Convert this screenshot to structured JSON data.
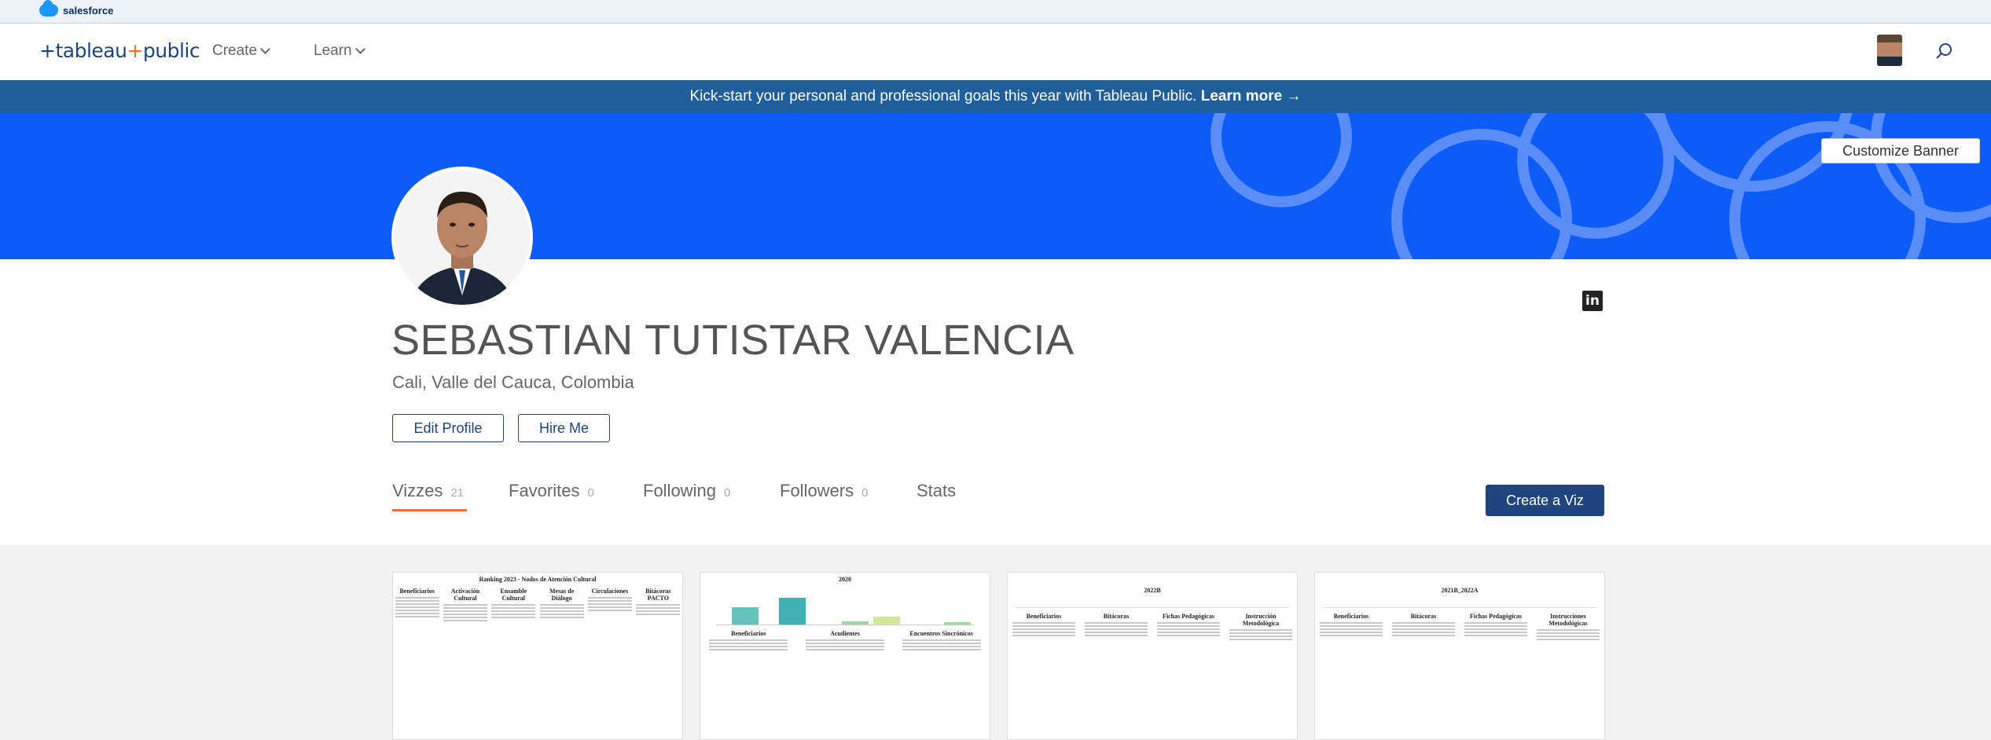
{
  "salesforce": {
    "brand": "salesforce"
  },
  "nav": {
    "logo_main": "+tableau",
    "logo_plus": "+",
    "logo_public": "public",
    "create": "Create",
    "learn": "Learn"
  },
  "promo": {
    "text": "Kick-start your personal and professional goals this year with Tableau Public. ",
    "link": "Learn more →"
  },
  "banner": {
    "customize": "Customize Banner"
  },
  "profile": {
    "name": "SEBASTIAN TUTISTAR VALENCIA",
    "location": "Cali, Valle del Cauca, Colombia",
    "edit": "Edit Profile",
    "hire": "Hire Me"
  },
  "tabs": [
    {
      "label": "Vizzes",
      "count": "21"
    },
    {
      "label": "Favorites",
      "count": "0"
    },
    {
      "label": "Following",
      "count": "0"
    },
    {
      "label": "Followers",
      "count": "0"
    },
    {
      "label": "Stats",
      "count": ""
    }
  ],
  "create_viz": "Create a Viz",
  "cards": [
    {
      "title": "Ranking 2023 - Nodos de Atención Cultural",
      "headers": [
        "Beneficiarios",
        "Activación Cultural",
        "Ensamble Cultural",
        "Mesas de Diálogo",
        "Circulaciones",
        "Bitácoras PACTO"
      ]
    },
    {
      "title": "2020",
      "headers": [
        "Beneficiarios",
        "Acudientes",
        "Encuentros Sincrónicos"
      ]
    },
    {
      "title": "2022B",
      "headers": [
        "Beneficiarios",
        "Bitácoras",
        "Fichas Pedagógicas",
        "Instrucción Metodológica"
      ]
    },
    {
      "title": "2021B_2022A",
      "headers": [
        "Beneficiarios",
        "Bitácoras",
        "Fichas Pedagógicas",
        "Instrucciones Metodológicas"
      ]
    }
  ],
  "colors": {
    "brand_blue": "#1f447e",
    "banner": "#0d5cf7",
    "accent_orange": "#e8762d"
  }
}
